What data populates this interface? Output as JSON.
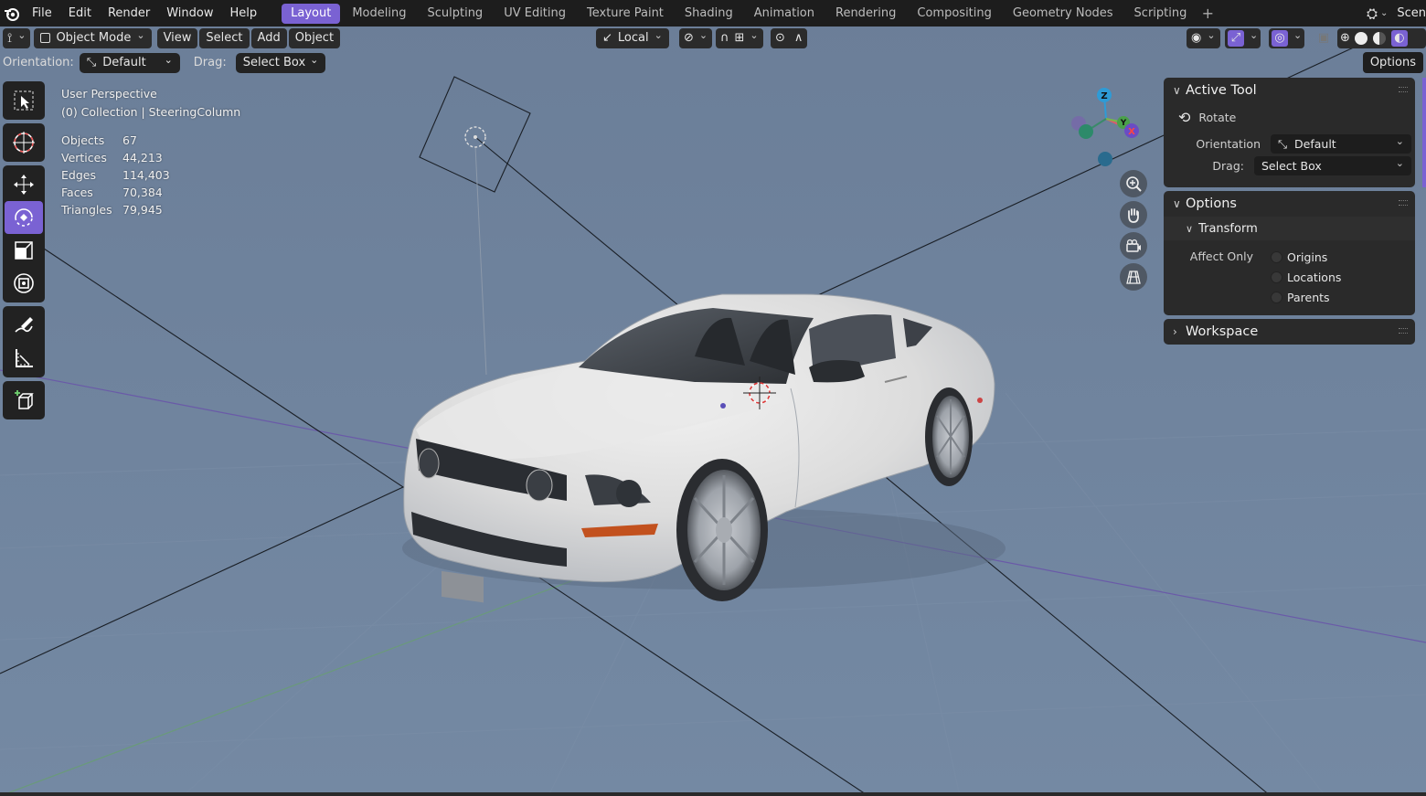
{
  "menu": [
    "File",
    "Edit",
    "Render",
    "Window",
    "Help"
  ],
  "workspaces": [
    {
      "label": "Layout",
      "active": true
    },
    {
      "label": "Modeling"
    },
    {
      "label": "Sculpting"
    },
    {
      "label": "UV Editing"
    },
    {
      "label": "Texture Paint"
    },
    {
      "label": "Shading"
    },
    {
      "label": "Animation"
    },
    {
      "label": "Rendering"
    },
    {
      "label": "Compositing"
    },
    {
      "label": "Geometry Nodes"
    },
    {
      "label": "Scripting"
    }
  ],
  "scene_label": "Scen",
  "header": {
    "mode": "Object Mode",
    "view": "View",
    "select": "Select",
    "add": "Add",
    "object": "Object",
    "transform_orientation": "Local"
  },
  "tool_settings": {
    "orientation_label": "Orientation:",
    "orientation_value": "Default",
    "drag_label": "Drag:",
    "drag_value": "Select Box",
    "options": "Options"
  },
  "overlay": {
    "view_name": "User Perspective",
    "collection": "(0) Collection | SteeringColumn",
    "stats": [
      {
        "key": "Objects",
        "value": "67"
      },
      {
        "key": "Vertices",
        "value": "44,213"
      },
      {
        "key": "Edges",
        "value": "114,403"
      },
      {
        "key": "Faces",
        "value": "70,384"
      },
      {
        "key": "Triangles",
        "value": "79,945"
      }
    ]
  },
  "gizmo": {
    "x": "X",
    "y": "Y",
    "z": "Z"
  },
  "panel": {
    "active_tool_title": "Active Tool",
    "tool_name": "Rotate",
    "orientation_label": "Orientation",
    "orientation_value": "Default",
    "drag_label": "Drag:",
    "drag_value": "Select Box",
    "options_title": "Options",
    "transform_title": "Transform",
    "affect_only_label": "Affect Only",
    "affect_items": [
      "Origins",
      "Locations",
      "Parents"
    ],
    "workspace_title": "Workspace"
  },
  "colors": {
    "accent": "#7a62d3",
    "viewport_bg": "#6f829c",
    "x_axis": "#e05a6a",
    "y_axis": "#7ab84a",
    "z_axis": "#2e9bd6"
  }
}
